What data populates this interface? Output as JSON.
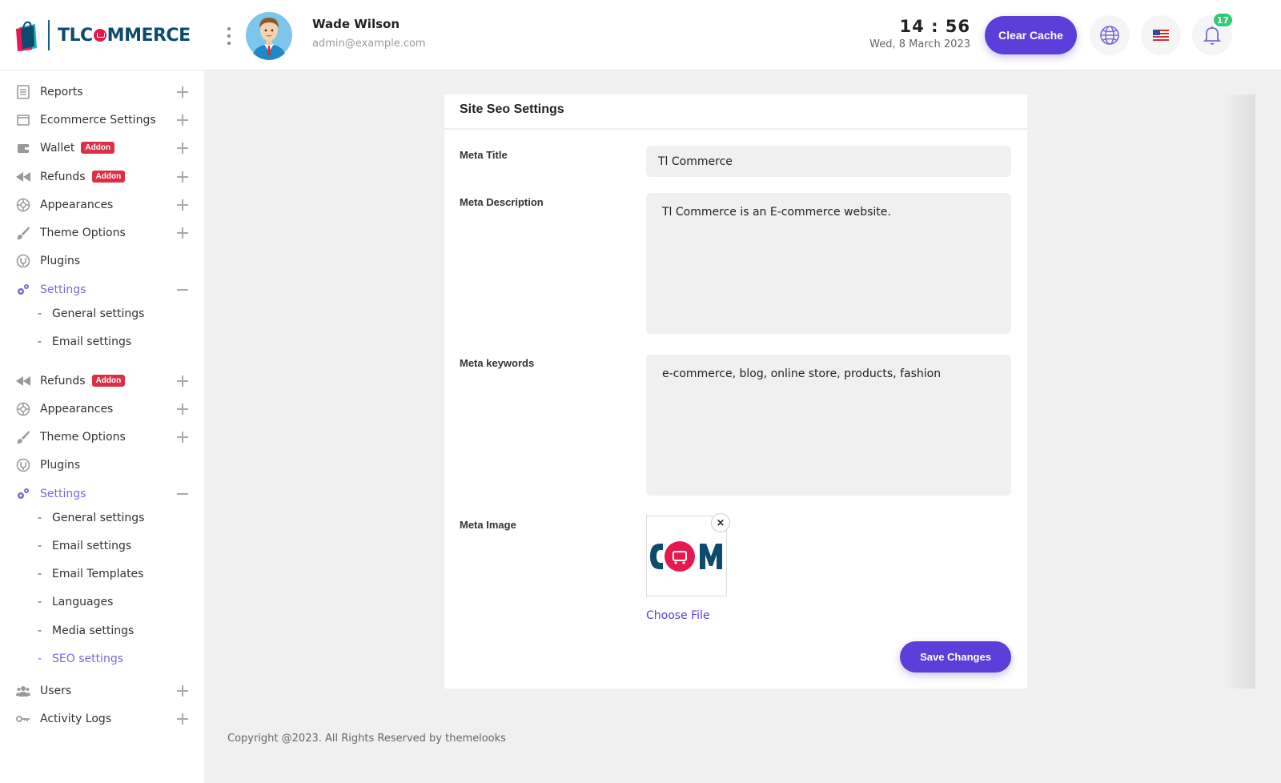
{
  "brand": {
    "name": "TLCOMMERCE",
    "name_before": "TLC",
    "name_after": "MMERCE"
  },
  "user": {
    "name": "Wade Wilson",
    "email": "admin@example.com"
  },
  "clock": {
    "time": "14 : 56",
    "date": "Wed, 8 March 2023"
  },
  "header": {
    "clear_cache_label": "Clear Cache",
    "notification_count": "17"
  },
  "sidebar": {
    "items": [
      {
        "label": "Reports",
        "icon": "reports-icon",
        "expand": "plus"
      },
      {
        "label": "Ecommerce Settings",
        "icon": "window-icon",
        "expand": "plus"
      },
      {
        "label": "Wallet",
        "icon": "wallet-icon",
        "badge": "Addon",
        "expand": "plus"
      },
      {
        "label": "Refunds",
        "icon": "rewind-icon",
        "badge": "Addon",
        "expand": "plus"
      },
      {
        "label": "Appearances",
        "icon": "appearance-icon",
        "expand": "plus"
      },
      {
        "label": "Theme Options",
        "icon": "brush-icon",
        "expand": "plus"
      },
      {
        "label": "Plugins",
        "icon": "plugin-icon"
      },
      {
        "label": "Settings",
        "icon": "gears-icon",
        "expand": "minus",
        "active": true
      },
      {
        "label": "General settings",
        "sub": true
      },
      {
        "label": "Email settings",
        "sub": true
      },
      {
        "label": "Refunds",
        "icon": "rewind-icon",
        "badge": "Addon",
        "expand": "plus"
      },
      {
        "label": "Appearances",
        "icon": "appearance-icon",
        "expand": "plus"
      },
      {
        "label": "Theme Options",
        "icon": "brush-icon",
        "expand": "plus"
      },
      {
        "label": "Plugins",
        "icon": "plugin-icon"
      },
      {
        "label": "Settings",
        "icon": "gears-icon",
        "expand": "minus",
        "active": true
      },
      {
        "label": "General settings",
        "sub": true
      },
      {
        "label": "Email settings",
        "sub": true
      },
      {
        "label": "Email Templates",
        "sub": true
      },
      {
        "label": "Languages",
        "sub": true
      },
      {
        "label": "Media settings",
        "sub": true
      },
      {
        "label": "SEO settings",
        "sub": true,
        "active": true
      },
      {
        "label": "Users",
        "icon": "users-icon",
        "expand": "plus"
      },
      {
        "label": "Activity Logs",
        "icon": "key-icon",
        "expand": "plus"
      }
    ],
    "dash": "-"
  },
  "form": {
    "title": "Site Seo Settings",
    "meta_title_label": "Meta Title",
    "meta_title_value": "Tl Commerce",
    "meta_description_label": "Meta Description",
    "meta_description_value": "Tl Commerce is an E-commerce website.",
    "meta_keywords_label": "Meta keywords",
    "meta_keywords_value": "e-commerce, blog, online store, products, fashion",
    "meta_image_label": "Meta Image",
    "meta_image_text": "COM",
    "remove_symbol": "×",
    "choose_file_label": "Choose File",
    "save_label": "Save Changes"
  },
  "footer": {
    "copyright": "Copyright @2023. All Rights Reserved by themelooks"
  },
  "colors": {
    "accent": "#5b3fd8",
    "active_menu": "#7b68d9",
    "addon_badge": "#dc2f45",
    "notification": "#2ecc71"
  }
}
